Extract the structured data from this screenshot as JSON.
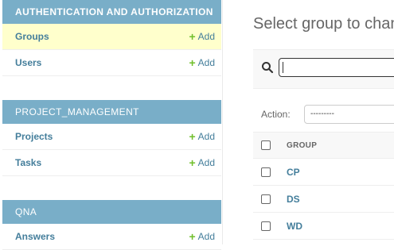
{
  "sidebar": {
    "modules": [
      {
        "title": "AUTHENTICATION AND AUTHORIZATION",
        "items": [
          {
            "label": "Groups",
            "add_label": "Add",
            "active": true
          },
          {
            "label": "Users",
            "add_label": "Add",
            "active": false
          }
        ]
      },
      {
        "title": "PROJECT_MANAGEMENT",
        "items": [
          {
            "label": "Projects",
            "add_label": "Add"
          },
          {
            "label": "Tasks",
            "add_label": "Add"
          }
        ]
      },
      {
        "title": "QNA",
        "items": [
          {
            "label": "Answers",
            "add_label": "Add"
          }
        ]
      }
    ],
    "add_icon": "plus-icon",
    "accent_color": "#79aec8",
    "active_row_color": "#ffffcc",
    "add_icon_color": "#70bf2b"
  },
  "main": {
    "title": "Select group to chan",
    "search": {
      "value": "",
      "icon": "search-icon"
    },
    "action": {
      "label": "Action:",
      "selected": "---------"
    },
    "table": {
      "column_header": "GROUP",
      "rows": [
        "CP",
        "DS",
        "WD"
      ]
    }
  }
}
